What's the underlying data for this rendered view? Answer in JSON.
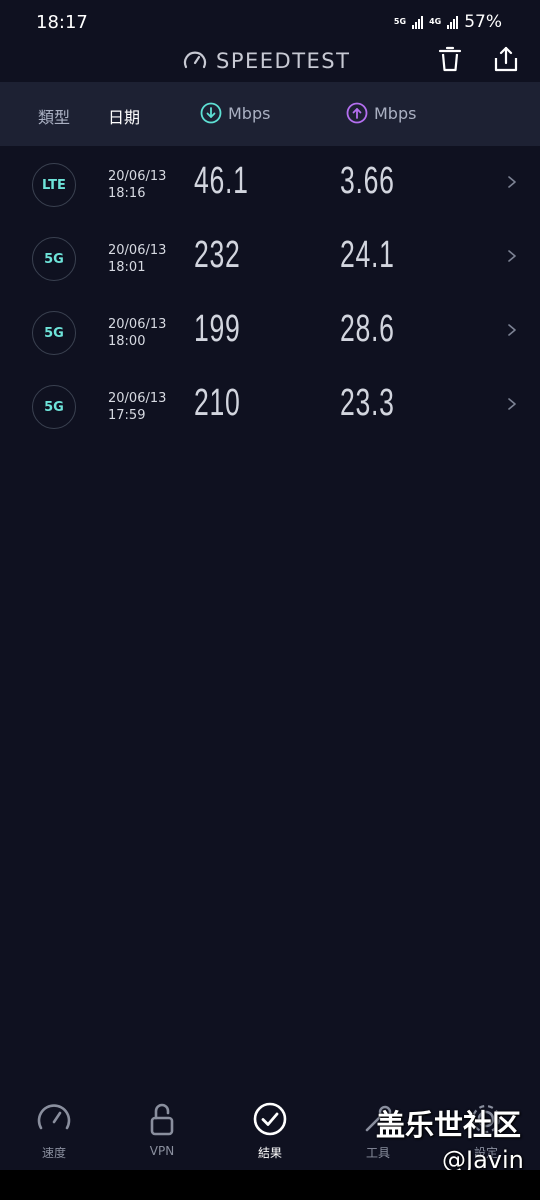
{
  "status_bar": {
    "time": "18:17",
    "net_tag_1": "5G",
    "net_tag_2": "4G",
    "battery": "57%"
  },
  "header": {
    "title": "SPEEDTEST",
    "icons": [
      "speedometer-icon",
      "trash-icon",
      "share-icon"
    ]
  },
  "columns": {
    "type": "類型",
    "date": "日期",
    "download_unit": "Mbps",
    "upload_unit": "Mbps"
  },
  "results": [
    {
      "type": "LTE",
      "date": "20/06/13",
      "time": "18:16",
      "download": "46.1",
      "upload": "3.66"
    },
    {
      "type": "5G",
      "date": "20/06/13",
      "time": "18:01",
      "download": "232",
      "upload": "24.1"
    },
    {
      "type": "5G",
      "date": "20/06/13",
      "time": "18:00",
      "download": "199",
      "upload": "28.6"
    },
    {
      "type": "5G",
      "date": "20/06/13",
      "time": "17:59",
      "download": "210",
      "upload": "23.3"
    }
  ],
  "nav": {
    "items": [
      {
        "label": "速度",
        "icon": "speedometer-icon"
      },
      {
        "label": "VPN",
        "icon": "unlock-icon"
      },
      {
        "label": "結果",
        "icon": "check-circle-icon",
        "active": true
      },
      {
        "label": "工具",
        "icon": "tools-icon"
      },
      {
        "label": "設定",
        "icon": "settings-icon"
      }
    ]
  },
  "watermark": {
    "main": "盖乐世社区",
    "sub": "@Javin"
  },
  "colors": {
    "background": "#0f1120",
    "header_row": "#1d2133",
    "accent_download": "#5ee0d4",
    "accent_upload": "#b46ff0",
    "badge_text": "#6ee3d9"
  }
}
